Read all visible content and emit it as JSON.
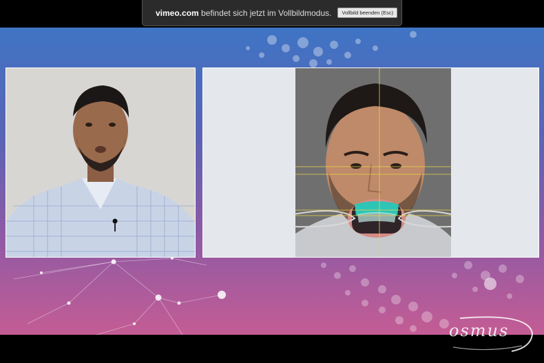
{
  "fullscreen_banner": {
    "domain": "vimeo.com",
    "message": "befindet sich jetzt im Vollbildmodus.",
    "exit_button": "Vollbild beenden (Esc)"
  },
  "logo": {
    "text": "osmus",
    "icon": "swoosh-logo"
  },
  "colors": {
    "stage_top": "#3f74c4",
    "stage_bottom": "#c45c94",
    "guide_line": "#e8d44a",
    "tray": "#2ec4b6"
  }
}
